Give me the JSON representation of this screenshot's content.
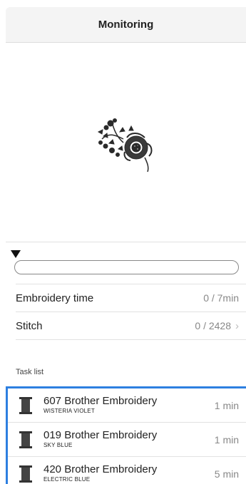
{
  "header": {
    "title": "Monitoring"
  },
  "progress": {
    "fraction": 0.0
  },
  "rows": [
    {
      "label": "Embroidery time",
      "value": "0 / 7min"
    },
    {
      "label": "Stitch",
      "value": "0 / 2428"
    }
  ],
  "task_list": {
    "label": "Task list",
    "items": [
      {
        "name": "607 Brother Embroidery",
        "color": "WISTERIA VIOLET",
        "time": "1 min"
      },
      {
        "name": "019 Brother Embroidery",
        "color": "SKY BLUE",
        "time": "1 min"
      },
      {
        "name": "420 Brother Embroidery",
        "color": "ELECTRIC BLUE",
        "time": "5 min"
      }
    ]
  },
  "colors": {
    "accent": "#2d7fe0",
    "spool": "#333333"
  },
  "icons": {
    "design": "embroidery-design-preview",
    "spool": "thread-spool-icon",
    "chevron": "chevron-right-icon",
    "marker": "position-marker-icon"
  }
}
